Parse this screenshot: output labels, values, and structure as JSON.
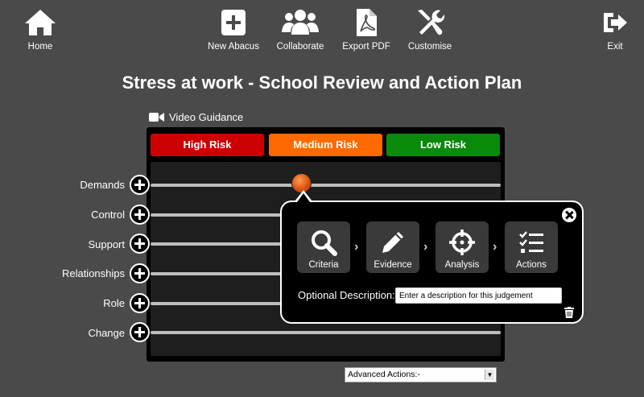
{
  "nav": {
    "home": "Home",
    "new_abacus": "New Abacus",
    "collaborate": "Collaborate",
    "export_pdf": "Export PDF",
    "customise": "Customise",
    "exit": "Exit"
  },
  "page_title": "Stress at work - School Review and Action Plan",
  "video_guidance": "Video Guidance",
  "risk": {
    "high": "High Risk",
    "medium": "Medium Risk",
    "low": "Low Risk"
  },
  "factors": [
    "Demands",
    "Control",
    "Support",
    "Relationships",
    "Role",
    "Change"
  ],
  "popup": {
    "steps": {
      "criteria": "Criteria",
      "evidence": "Evidence",
      "analysis": "Analysis",
      "actions": "Actions"
    },
    "desc_label": "Optional Description:",
    "desc_placeholder": "Enter a description for this judgement"
  },
  "advanced_actions": "Advanced Actions:-",
  "colors": {
    "high": "#cc0000",
    "medium": "#ff6a00",
    "low": "#0a8a0a",
    "background": "#4a4a4a"
  }
}
